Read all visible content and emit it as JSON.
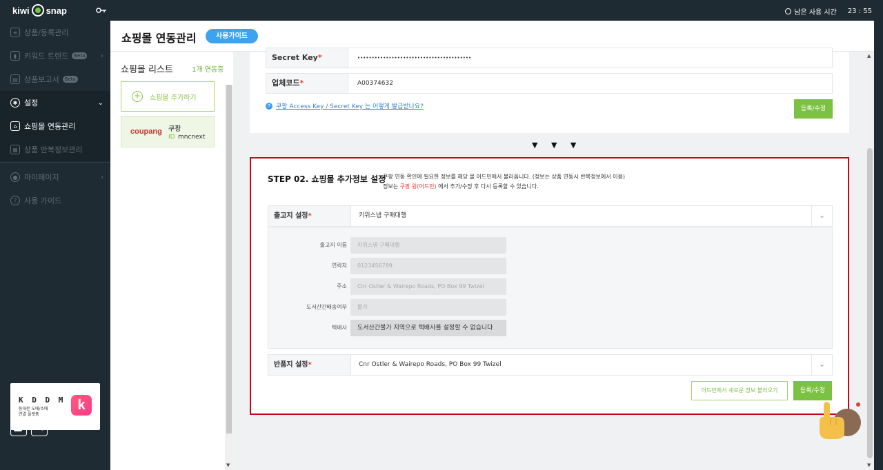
{
  "topbar": {
    "logo_left": "kiwi",
    "logo_right": "snap",
    "session_label": "남은 사용 시간",
    "session_time": "23 : 55"
  },
  "sidebar": {
    "items": [
      {
        "label": "상품/등록관리",
        "icon": "list-icon"
      },
      {
        "label": "키워드 트렌드",
        "icon": "chart-icon",
        "badge": "Beta"
      },
      {
        "label": "상품보고서",
        "icon": "report-icon",
        "badge": "Beta"
      },
      {
        "label": "설정",
        "icon": "gear-icon"
      },
      {
        "label": "쇼핑몰 연동관리",
        "icon": "store-icon"
      },
      {
        "label": "상품 반복정보관리",
        "icon": "grid-icon"
      },
      {
        "label": "마이페이지",
        "icon": "user-icon"
      },
      {
        "label": "사용 가이드",
        "icon": "question-icon"
      }
    ],
    "promo": {
      "title": "K D D M",
      "desc_line1": "동대문 도매/소매",
      "desc_line2": "연결 플랫폼",
      "app_letter": "k"
    },
    "blog_label": "blog"
  },
  "header": {
    "title": "쇼핑몰 연동관리",
    "guide_button": "사용가이드"
  },
  "mall_list": {
    "title": "쇼핑몰 리스트",
    "count": "1개 연동중",
    "add_button": "쇼핑몰 추가하기",
    "malls": [
      {
        "logo": "coupang",
        "name": "쿠팡",
        "id_label": "ID",
        "id": "mncnext"
      }
    ]
  },
  "step1": {
    "secret_key_label": "Secret Key",
    "secret_key_value": "••••••••••••••••••••••••••••••••••••••••",
    "vendor_code_label": "업체코드",
    "vendor_code_value": "A00374632",
    "help_link": "쿠팡 Access Key / Secret Key 는 어떻게 발급받나요?",
    "submit_button": "등록/수정"
  },
  "divider_arrows": "▼ ▼ ▼",
  "step2": {
    "title": "STEP 02. 쇼핑몰 추가정보 설정",
    "desc_line1": "쿠팡 연동 확인에 필요한 정보를 해당 몰 어드민에서 불러옵니다. (정보는 상품 연동시 반복정보에서 이용)",
    "desc_line2_pre": "정보는",
    "desc_line2_red": "쿠팡 윙(어드민)",
    "desc_line2_post": "에서 추가/수정 후 다시 등록할 수 있습니다.",
    "shipping_label": "출고지 설정",
    "shipping_value": "키위스냅 구매대행",
    "details": [
      {
        "key": "출고지 이름",
        "value": "키위스냅 구매대행"
      },
      {
        "key": "연락처",
        "value": "0123456789"
      },
      {
        "key": "주소",
        "value": "Cnr Ostler & Wairepo Roads, PO Box 99 Twizel"
      },
      {
        "key": "도서산간배송여부",
        "value": "불가"
      },
      {
        "key": "택배사",
        "value": "도서산간불가 지역으로 택배사를 설정할 수 없습니다"
      }
    ],
    "return_label": "반품지 설정",
    "return_value": "Cnr Ostler & Wairepo Roads, PO Box 99 Twizel",
    "fetch_button": "어드민에서 새로운 정보 불러오기",
    "submit_button": "등록/수정"
  },
  "colors": {
    "brand_green": "#7bc142",
    "accent_blue": "#3ca3f0",
    "highlight_red": "#d0021b",
    "sidebar_bg": "#1e2b33"
  }
}
